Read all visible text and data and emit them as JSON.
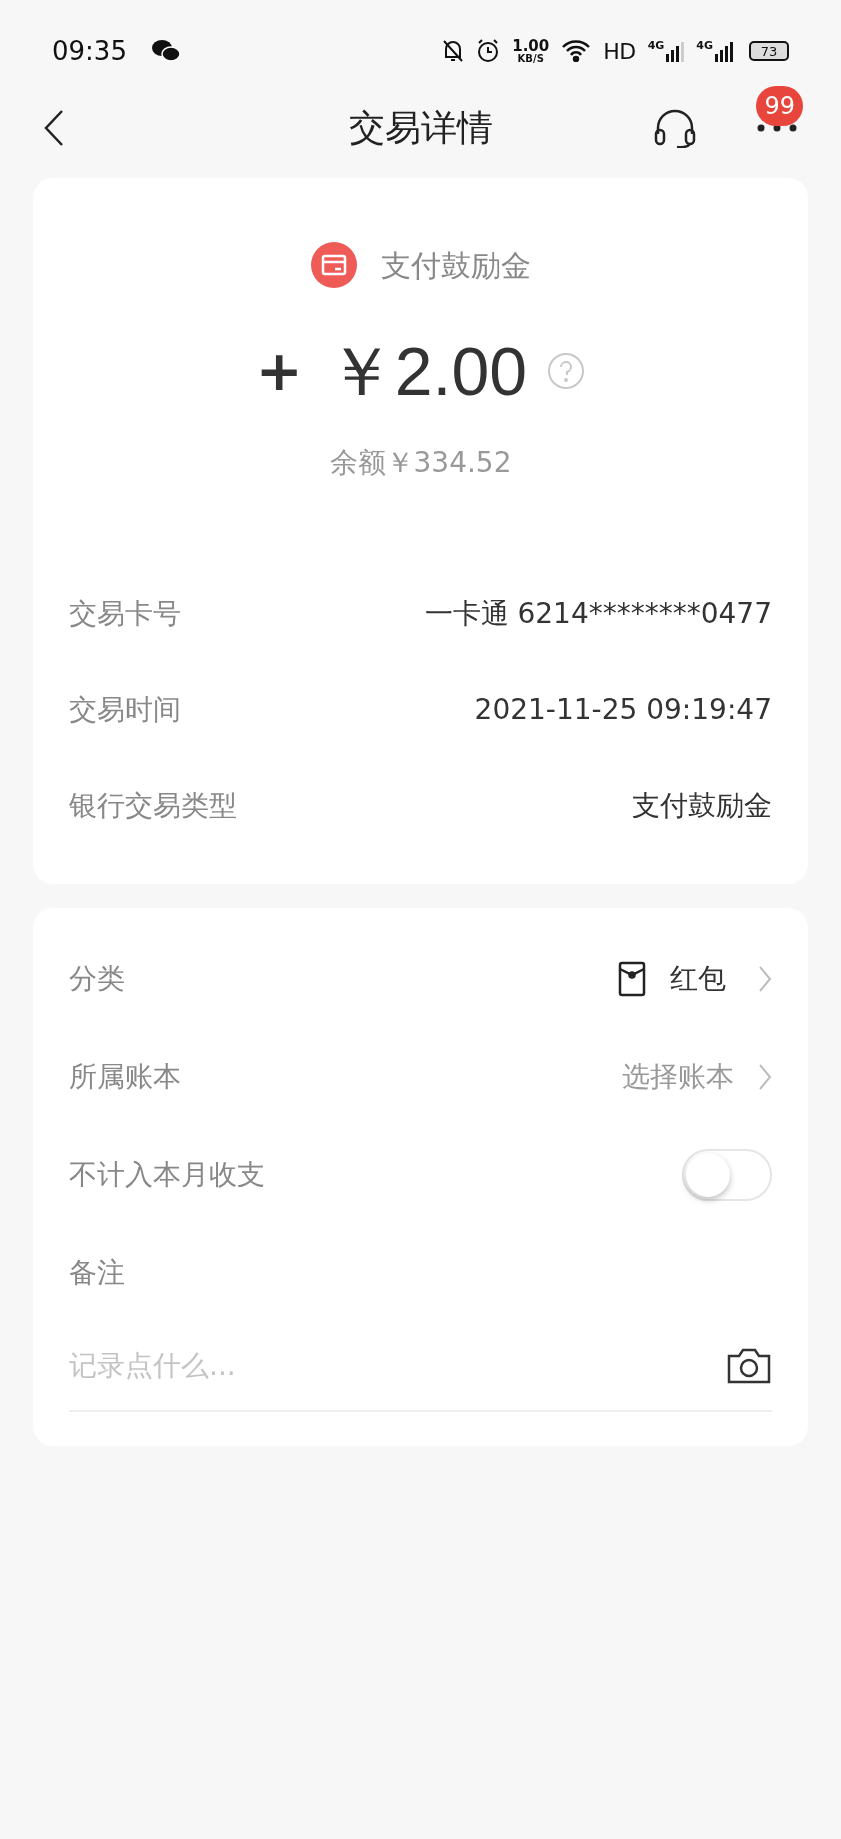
{
  "status_bar": {
    "time": "09:35",
    "speed": "1.00",
    "speed_unit": "KB/S",
    "hd": "HD",
    "networks": [
      "4G",
      "4G"
    ],
    "battery": "73"
  },
  "header": {
    "title": "交易详情",
    "badge": "99"
  },
  "summary": {
    "category": "支付鼓励金",
    "sign": "+",
    "amount": "￥2.00",
    "balance": "余额￥334.52"
  },
  "details": [
    {
      "label": "交易卡号",
      "value": "一卡通 6214********0477"
    },
    {
      "label": "交易时间",
      "value": "2021-11-25 09:19:47"
    },
    {
      "label": "银行交易类型",
      "value": "支付鼓励金"
    }
  ],
  "settings": [
    {
      "kind": "category",
      "label": "分类",
      "value": "红包"
    },
    {
      "kind": "link",
      "label": "所属账本",
      "value": "选择账本"
    },
    {
      "kind": "toggle",
      "label": "不计入本月收支",
      "on": false
    }
  ],
  "note": {
    "label": "备注",
    "placeholder": "记录点什么..."
  }
}
